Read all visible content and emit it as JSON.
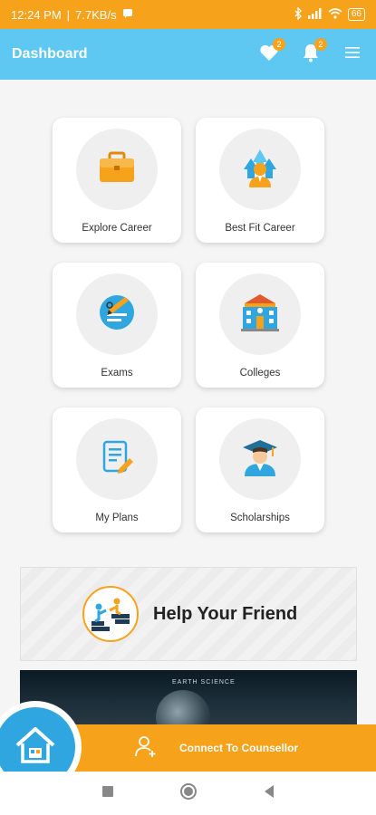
{
  "status": {
    "time": "12:24 PM",
    "speed": "7.7KB/s",
    "battery": "66"
  },
  "app_bar": {
    "title": "Dashboard",
    "favorites_badge": "2",
    "notifications_badge": "2"
  },
  "cards": [
    {
      "label": "Explore Career",
      "icon": "briefcase-icon"
    },
    {
      "label": "Best Fit Career",
      "icon": "person-arrows-icon"
    },
    {
      "label": "Exams",
      "icon": "exam-pencil-icon"
    },
    {
      "label": "Colleges",
      "icon": "college-building-icon"
    },
    {
      "label": "My Plans",
      "icon": "document-edit-icon"
    },
    {
      "label": "Scholarships",
      "icon": "graduate-icon"
    }
  ],
  "banner": {
    "text": "Help Your Friend"
  },
  "image_strip": {
    "label": "EARTH SCIENCE"
  },
  "connect": {
    "label": "Connect To Counsellor"
  },
  "colors": {
    "accent_orange": "#f7a21b",
    "app_bar_blue": "#5ec8f2",
    "fab_blue": "#2fa6e0"
  }
}
